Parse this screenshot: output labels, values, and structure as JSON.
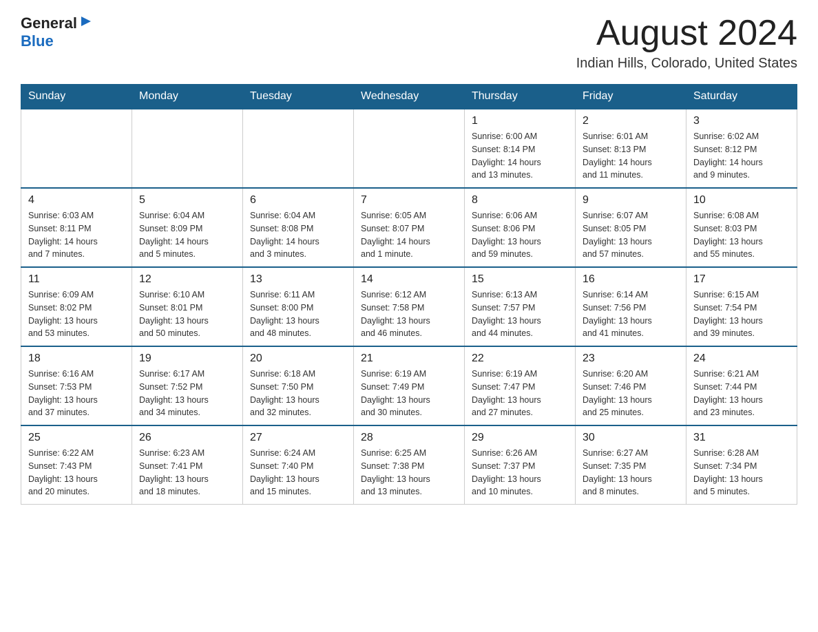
{
  "header": {
    "logo": {
      "general": "General",
      "blue": "Blue"
    },
    "title": "August 2024",
    "location": "Indian Hills, Colorado, United States"
  },
  "weekdays": [
    "Sunday",
    "Monday",
    "Tuesday",
    "Wednesday",
    "Thursday",
    "Friday",
    "Saturday"
  ],
  "weeks": [
    [
      {
        "day": "",
        "info": ""
      },
      {
        "day": "",
        "info": ""
      },
      {
        "day": "",
        "info": ""
      },
      {
        "day": "",
        "info": ""
      },
      {
        "day": "1",
        "info": "Sunrise: 6:00 AM\nSunset: 8:14 PM\nDaylight: 14 hours\nand 13 minutes."
      },
      {
        "day": "2",
        "info": "Sunrise: 6:01 AM\nSunset: 8:13 PM\nDaylight: 14 hours\nand 11 minutes."
      },
      {
        "day": "3",
        "info": "Sunrise: 6:02 AM\nSunset: 8:12 PM\nDaylight: 14 hours\nand 9 minutes."
      }
    ],
    [
      {
        "day": "4",
        "info": "Sunrise: 6:03 AM\nSunset: 8:11 PM\nDaylight: 14 hours\nand 7 minutes."
      },
      {
        "day": "5",
        "info": "Sunrise: 6:04 AM\nSunset: 8:09 PM\nDaylight: 14 hours\nand 5 minutes."
      },
      {
        "day": "6",
        "info": "Sunrise: 6:04 AM\nSunset: 8:08 PM\nDaylight: 14 hours\nand 3 minutes."
      },
      {
        "day": "7",
        "info": "Sunrise: 6:05 AM\nSunset: 8:07 PM\nDaylight: 14 hours\nand 1 minute."
      },
      {
        "day": "8",
        "info": "Sunrise: 6:06 AM\nSunset: 8:06 PM\nDaylight: 13 hours\nand 59 minutes."
      },
      {
        "day": "9",
        "info": "Sunrise: 6:07 AM\nSunset: 8:05 PM\nDaylight: 13 hours\nand 57 minutes."
      },
      {
        "day": "10",
        "info": "Sunrise: 6:08 AM\nSunset: 8:03 PM\nDaylight: 13 hours\nand 55 minutes."
      }
    ],
    [
      {
        "day": "11",
        "info": "Sunrise: 6:09 AM\nSunset: 8:02 PM\nDaylight: 13 hours\nand 53 minutes."
      },
      {
        "day": "12",
        "info": "Sunrise: 6:10 AM\nSunset: 8:01 PM\nDaylight: 13 hours\nand 50 minutes."
      },
      {
        "day": "13",
        "info": "Sunrise: 6:11 AM\nSunset: 8:00 PM\nDaylight: 13 hours\nand 48 minutes."
      },
      {
        "day": "14",
        "info": "Sunrise: 6:12 AM\nSunset: 7:58 PM\nDaylight: 13 hours\nand 46 minutes."
      },
      {
        "day": "15",
        "info": "Sunrise: 6:13 AM\nSunset: 7:57 PM\nDaylight: 13 hours\nand 44 minutes."
      },
      {
        "day": "16",
        "info": "Sunrise: 6:14 AM\nSunset: 7:56 PM\nDaylight: 13 hours\nand 41 minutes."
      },
      {
        "day": "17",
        "info": "Sunrise: 6:15 AM\nSunset: 7:54 PM\nDaylight: 13 hours\nand 39 minutes."
      }
    ],
    [
      {
        "day": "18",
        "info": "Sunrise: 6:16 AM\nSunset: 7:53 PM\nDaylight: 13 hours\nand 37 minutes."
      },
      {
        "day": "19",
        "info": "Sunrise: 6:17 AM\nSunset: 7:52 PM\nDaylight: 13 hours\nand 34 minutes."
      },
      {
        "day": "20",
        "info": "Sunrise: 6:18 AM\nSunset: 7:50 PM\nDaylight: 13 hours\nand 32 minutes."
      },
      {
        "day": "21",
        "info": "Sunrise: 6:19 AM\nSunset: 7:49 PM\nDaylight: 13 hours\nand 30 minutes."
      },
      {
        "day": "22",
        "info": "Sunrise: 6:19 AM\nSunset: 7:47 PM\nDaylight: 13 hours\nand 27 minutes."
      },
      {
        "day": "23",
        "info": "Sunrise: 6:20 AM\nSunset: 7:46 PM\nDaylight: 13 hours\nand 25 minutes."
      },
      {
        "day": "24",
        "info": "Sunrise: 6:21 AM\nSunset: 7:44 PM\nDaylight: 13 hours\nand 23 minutes."
      }
    ],
    [
      {
        "day": "25",
        "info": "Sunrise: 6:22 AM\nSunset: 7:43 PM\nDaylight: 13 hours\nand 20 minutes."
      },
      {
        "day": "26",
        "info": "Sunrise: 6:23 AM\nSunset: 7:41 PM\nDaylight: 13 hours\nand 18 minutes."
      },
      {
        "day": "27",
        "info": "Sunrise: 6:24 AM\nSunset: 7:40 PM\nDaylight: 13 hours\nand 15 minutes."
      },
      {
        "day": "28",
        "info": "Sunrise: 6:25 AM\nSunset: 7:38 PM\nDaylight: 13 hours\nand 13 minutes."
      },
      {
        "day": "29",
        "info": "Sunrise: 6:26 AM\nSunset: 7:37 PM\nDaylight: 13 hours\nand 10 minutes."
      },
      {
        "day": "30",
        "info": "Sunrise: 6:27 AM\nSunset: 7:35 PM\nDaylight: 13 hours\nand 8 minutes."
      },
      {
        "day": "31",
        "info": "Sunrise: 6:28 AM\nSunset: 7:34 PM\nDaylight: 13 hours\nand 5 minutes."
      }
    ]
  ]
}
